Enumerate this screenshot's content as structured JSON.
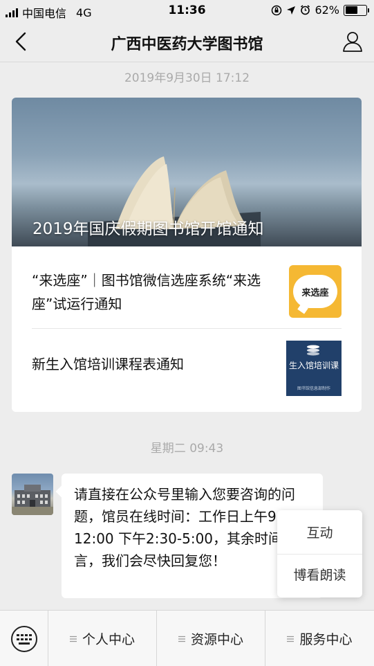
{
  "status_bar": {
    "carrier": "中国电信",
    "network": "4G",
    "time": "11:36",
    "battery": "62%",
    "battery_level": 0.62
  },
  "nav": {
    "title": "广西中医药大学图书馆"
  },
  "chat": {
    "timestamp_1": "2019年9月30日 17:12",
    "article": {
      "cover_title": "2019年国庆假期图书馆开馆通知",
      "items": [
        {
          "title": "“来选座”｜图书馆微信选座系统“来选座”试运行通知",
          "thumb_text": "来选座"
        },
        {
          "title": "新生入馆培训课程表通知",
          "thumb_text": "生入馆培训课",
          "thumb_footer": "图书馆信息部制作"
        }
      ]
    },
    "timestamp_2": "星期二 09:43",
    "message": "请直接在公众号里输入您要咨询的问题，馆员在线时间：工作日上午9:00-12:00 下午2:30-5:00，其余时间请留言，我们会尽快回复您！"
  },
  "popup_menu": {
    "items": [
      "互动",
      "博看朗读"
    ]
  },
  "bottom_menu": {
    "tabs": [
      "个人中心",
      "资源中心",
      "服务中心"
    ]
  },
  "colors": {
    "background": "#ededed",
    "card": "#ffffff",
    "timestamp": "#aaaaaa",
    "seat_thumb": "#f5b833",
    "training_thumb": "#21406a"
  }
}
